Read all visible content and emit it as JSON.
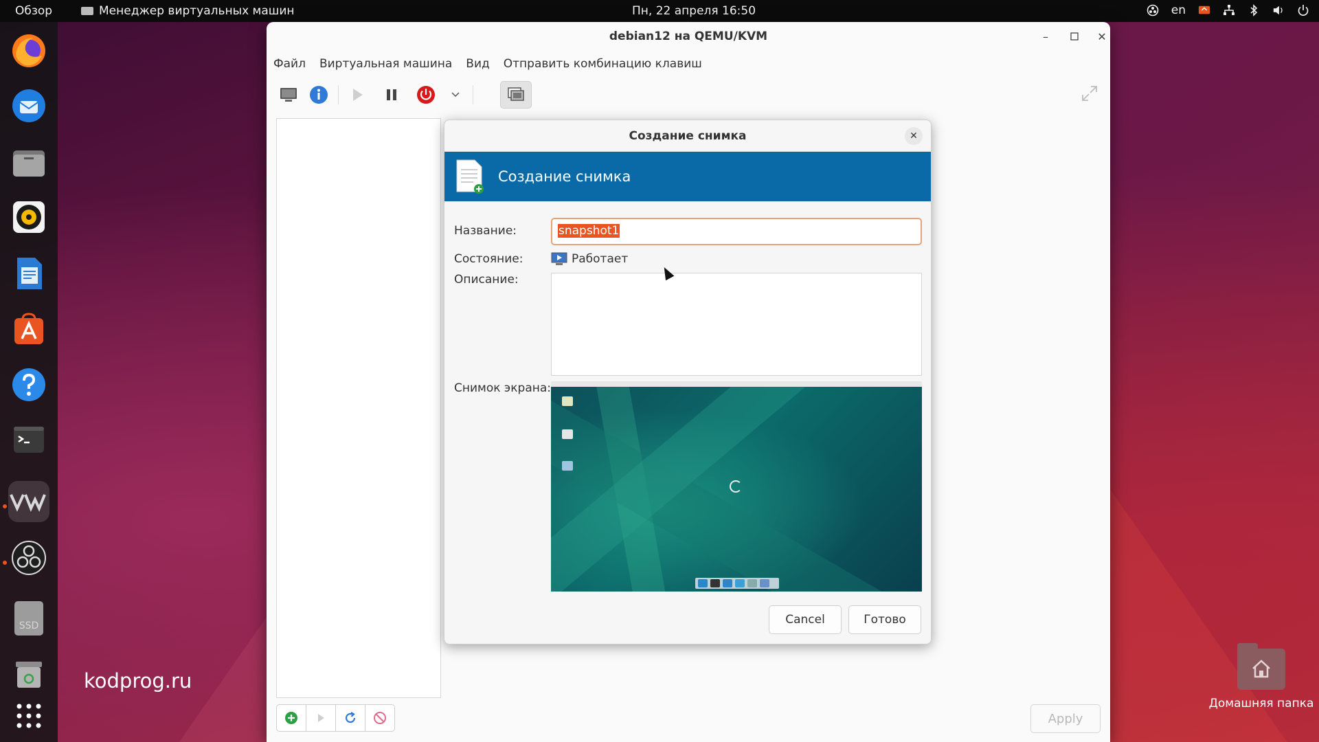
{
  "topbar": {
    "overview": "Обзор",
    "app_name": "Менеджер виртуальных машин",
    "datetime": "Пн, 22 апреля  16:50",
    "lang": "en"
  },
  "dock": {
    "items": [
      "firefox-icon",
      "thunderbird-icon",
      "files-icon",
      "rhythmbox-icon",
      "writer-icon",
      "app-center-icon",
      "help-icon",
      "terminal-icon",
      "virt-manager-icon",
      "obs-icon",
      "ssd-drive-icon",
      "trash-icon",
      "app-grid-icon"
    ],
    "ssd_label": "SSD"
  },
  "watermark": "kodprog.ru",
  "desktop": {
    "home_folder": "Домашняя папка"
  },
  "window": {
    "title": "debian12 на QEMU/KVM",
    "menu": [
      "Файл",
      "Виртуальная машина",
      "Вид",
      "Отправить комбинацию клавиш"
    ],
    "apply": "Apply"
  },
  "dialog": {
    "title": "Создание снимка",
    "header": "Создание снимка",
    "name_label": "Название:",
    "name_value": "snapshot1",
    "state_label": "Состояние:",
    "state_value": "Работает",
    "desc_label": "Описание:",
    "screenshot_label": "Снимок экрана:",
    "cancel": "Cancel",
    "done": "Готово"
  },
  "colors": {
    "accent": "#e95420",
    "banner": "#0a6aa8",
    "power": "#d7191c"
  }
}
